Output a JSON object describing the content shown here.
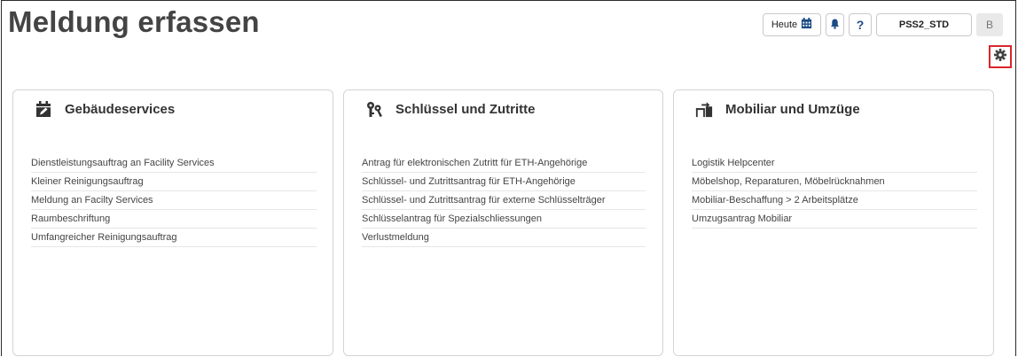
{
  "header": {
    "title": "Meldung erfassen",
    "today_label": "Heute",
    "help_label": "?",
    "user_label": "PSS2_STD",
    "avatar_label": "B"
  },
  "icons": {
    "today": "calendar-icon",
    "bell": "bell-icon",
    "settings": "gear-icon",
    "cards": [
      "calendar-edit-icon",
      "keys-icon",
      "moving-furniture-icon"
    ]
  },
  "colors": {
    "accent": "#1b4a86",
    "highlight_border": "#d9262b"
  },
  "cards": [
    {
      "title": "Gebäudeservices",
      "items": [
        "Dienstleistungsauftrag an Facility Services",
        "Kleiner Reinigungsauftrag",
        "Meldung an Facilty Services",
        "Raumbeschriftung",
        "Umfangreicher Reinigungsauftrag"
      ]
    },
    {
      "title": "Schlüssel und Zutritte",
      "items": [
        "Antrag für elektronischen Zutritt für ETH-Angehörige",
        "Schlüssel- und Zutrittsantrag für ETH-Angehörige",
        "Schlüssel- und Zutrittsantrag für externe Schlüsselträger",
        "Schlüsselantrag für Spezialschliessungen",
        "Verlustmeldung"
      ]
    },
    {
      "title": "Mobiliar und Umzüge",
      "items": [
        "Logistik Helpcenter",
        "Möbelshop, Reparaturen, Möbelrücknahmen",
        "Mobiliar-Beschaffung > 2 Arbeitsplätze",
        "Umzugsantrag Mobiliar"
      ]
    }
  ]
}
